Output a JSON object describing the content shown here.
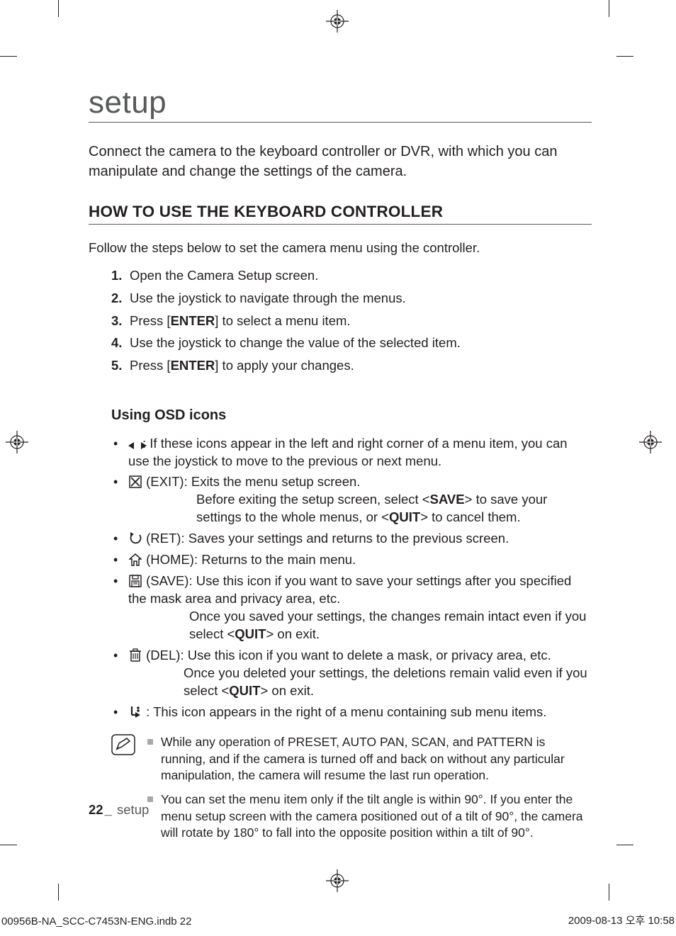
{
  "pageTitle": "setup",
  "intro": "Connect the camera to the keyboard controller or DVR, with which you can manipulate and change the settings of the camera.",
  "sectionTitle": "HOW TO USE THE KEYBOARD CONTROLLER",
  "followText": "Follow the steps below to set the camera menu using the controller.",
  "steps": {
    "s1": "Open the Camera Setup screen.",
    "s2": "Use the joystick to navigate through the menus.",
    "s3a": "Press [",
    "s3b": "ENTER",
    "s3c": "] to select a menu item.",
    "s4": "Use the joystick to change the value of the selected item.",
    "s5a": "Press [",
    "s5b": "ENTER",
    "s5c": "] to apply your changes."
  },
  "subTitle": "Using OSD icons",
  "osd": {
    "arrows": {
      "body": ": If these icons appear in the left and right corner of a menu item, you can use the joystick to move to the previous or next menu."
    },
    "exit": {
      "label": " (EXIT): Exits the menu setup screen.",
      "line2a": "Before exiting the setup screen, select <",
      "line2b": "SAVE",
      "line2c": "> to save your settings to the whole menus, or <",
      "line2d": "QUIT",
      "line2e": "> to cancel them."
    },
    "ret": {
      "label": " (RET): Saves your settings and returns to the previous screen."
    },
    "home": {
      "label": " (HOME): Returns to the main menu."
    },
    "save": {
      "label": " (SAVE): Use this icon if you want to save your settings after you specified the mask area and privacy area, etc.",
      "line2a": "Once you saved your settings, the changes remain intact even if you select <",
      "line2b": "QUIT",
      "line2c": "> on exit."
    },
    "del": {
      "label": " (DEL): Use this icon if you want to delete a mask, or privacy area, etc.",
      "line2a": "Once you deleted your settings, the deletions remain valid even if you select <",
      "line2b": "QUIT",
      "line2c": "> on exit."
    },
    "sub": {
      "label": " : This icon appears in the right of a menu containing sub menu items."
    }
  },
  "notes": {
    "n1": "While any operation of PRESET, AUTO PAN, SCAN, and PATTERN is running, and if the camera is turned off and back on without any particular manipulation, the camera will resume the last run operation.",
    "n2": "You can set the menu item only if the tilt angle is within 90°. If you enter the menu setup screen with the camera positioned out of a tilt of 90°, the camera will rotate by 180° to fall into the opposite position within a tilt of 90°."
  },
  "footer": {
    "pageNum": "22",
    "sep": "_",
    "section": " setup",
    "file": "00956B-NA_SCC-C7453N-ENG.indb   22",
    "time": "2009-08-13   오후 10:58"
  }
}
